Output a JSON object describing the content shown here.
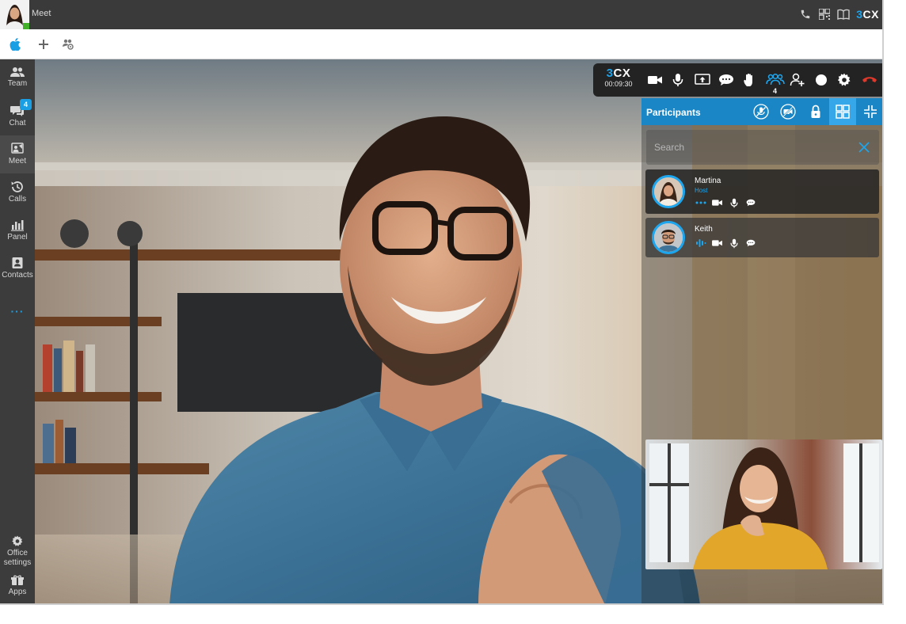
{
  "topbar": {
    "app_title": "Meet",
    "brand_prefix": "3",
    "brand_suffix": "CX",
    "icons": [
      "phone-icon",
      "qr-code-icon",
      "book-icon"
    ]
  },
  "subbar": {
    "icons": [
      "apple-icon",
      "plus-icon",
      "group-settings-icon"
    ]
  },
  "sidebar": {
    "items": [
      {
        "label": "Team",
        "icon": "team-icon"
      },
      {
        "label": "Chat",
        "icon": "chat-icon",
        "badge": "4"
      },
      {
        "label": "Meet",
        "icon": "meet-icon"
      },
      {
        "label": "Calls",
        "icon": "history-icon"
      },
      {
        "label": "Panel",
        "icon": "panel-icon"
      },
      {
        "label": "Contacts",
        "icon": "contacts-icon"
      },
      {
        "label": "Office settings",
        "icon": "gear-icon"
      },
      {
        "label": "Apps",
        "icon": "apps-icon"
      }
    ],
    "more": "···"
  },
  "call": {
    "logo_prefix": "3",
    "logo_suffix": "CX",
    "timer": "00:09:30",
    "participant_count": "4",
    "buttons": [
      "camera-icon",
      "microphone-icon",
      "share-screen-icon",
      "chat-bubble-icon",
      "raise-hand-icon",
      "participants-icon",
      "add-user-icon",
      "record-icon",
      "settings-icon",
      "hang-up-icon"
    ]
  },
  "participants_panel": {
    "title": "Participants",
    "header_buttons": [
      "mute-all-icon",
      "disable-video-icon",
      "lock-icon",
      "grid-view-icon",
      "collapse-icon"
    ],
    "search_placeholder": "Search",
    "participants": [
      {
        "name": "Martina",
        "role": "Host"
      },
      {
        "name": "Keith",
        "role": ""
      }
    ]
  },
  "colors": {
    "accent": "#1a86c6",
    "accent_light": "#1da6ee",
    "topbar": "#3a3a3a",
    "sidebar": "#3c3c3c",
    "hangup": "#e0392b",
    "status_green": "#43b02a"
  }
}
